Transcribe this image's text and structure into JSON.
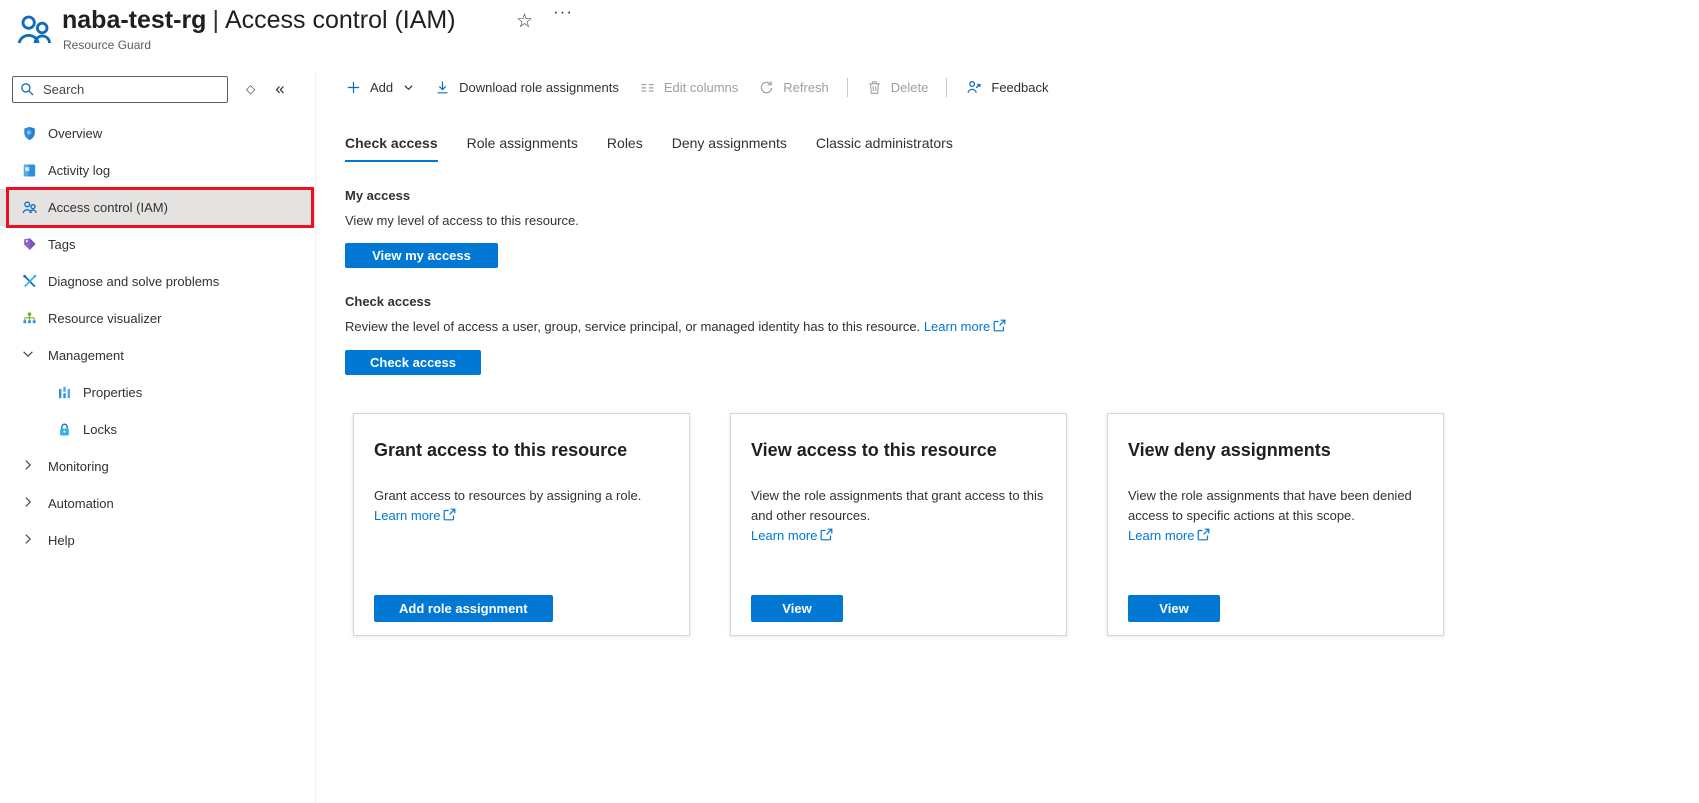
{
  "header": {
    "title_name": "naba-test-rg",
    "title_sep": "|",
    "title_page": "Access control (IAM)",
    "subtitle": "Resource Guard"
  },
  "icons": {
    "star": "☆",
    "more": "···",
    "collapse": "«",
    "keyboard_hint": "◇"
  },
  "sidebar": {
    "search": {
      "placeholder": "Search"
    },
    "items": [
      {
        "label": "Overview",
        "icon": "shield-icon"
      },
      {
        "label": "Activity log",
        "icon": "activity-log-icon"
      },
      {
        "label": "Access control (IAM)",
        "icon": "people-icon",
        "active": true,
        "annotated": true
      },
      {
        "label": "Tags",
        "icon": "tag-icon"
      },
      {
        "label": "Diagnose and solve problems",
        "icon": "tools-icon"
      },
      {
        "label": "Resource visualizer",
        "icon": "tree-icon"
      },
      {
        "label": "Management",
        "icon": "chevron-down-icon",
        "group": true,
        "expanded": true
      },
      {
        "label": "Properties",
        "icon": "bars-icon",
        "child": true
      },
      {
        "label": "Locks",
        "icon": "lock-icon",
        "child": true
      },
      {
        "label": "Monitoring",
        "icon": "chevron-right-icon",
        "group": true,
        "expanded": false
      },
      {
        "label": "Automation",
        "icon": "chevron-right-icon",
        "group": true,
        "expanded": false
      },
      {
        "label": "Help",
        "icon": "chevron-right-icon",
        "group": true,
        "expanded": false
      }
    ]
  },
  "toolbar": {
    "add": "Add",
    "download": "Download role assignments",
    "edit_columns": "Edit columns",
    "refresh": "Refresh",
    "delete": "Delete",
    "feedback": "Feedback"
  },
  "tabs": {
    "active": "Check access",
    "items": [
      "Check access",
      "Role assignments",
      "Roles",
      "Deny assignments",
      "Classic administrators"
    ]
  },
  "main": {
    "my_access": {
      "title": "My access",
      "description": "View my level of access to this resource.",
      "button": "View my access"
    },
    "check_access": {
      "title": "Check access",
      "description": "Review the level of access a user, group, service principal, or managed identity has to this resource.",
      "link": "Learn more",
      "button": "Check access"
    },
    "cards": [
      {
        "title": "Grant access to this resource",
        "description": "Grant access to resources by assigning a role.",
        "link": "Learn more",
        "button": "Add role assignment"
      },
      {
        "title": "View access to this resource",
        "description": "View the role assignments that grant access to this and other resources.",
        "link": "Learn more",
        "button": "View"
      },
      {
        "title": "View deny assignments",
        "description": "View the role assignments that have been denied access to specific actions at this scope.",
        "link": "Learn more",
        "button": "View"
      }
    ]
  },
  "colors": {
    "accent": "#0078d4",
    "annotation_red": "#e81123",
    "disabled_text": "#a19f9d",
    "active_row_bg": "#e4e3e2"
  }
}
